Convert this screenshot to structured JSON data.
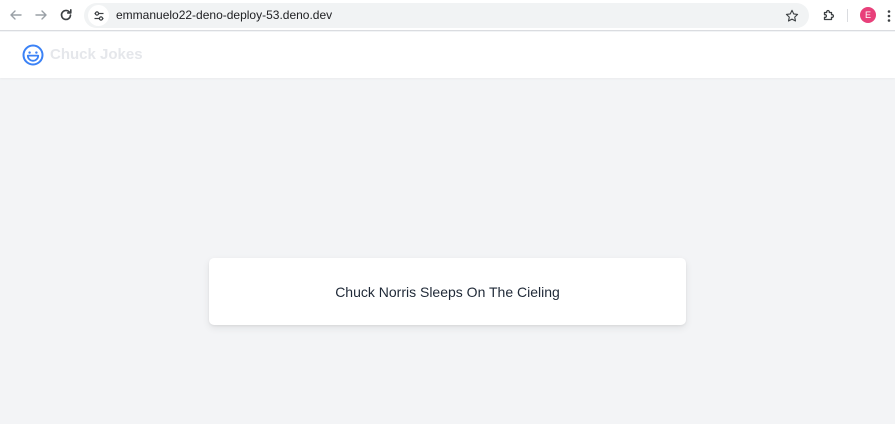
{
  "browser": {
    "url": "emmanuelo22-deno-deploy-53.deno.dev",
    "profile_initial": "E",
    "colors": {
      "profile": "#e8407a",
      "address_bar": "#f1f3f4"
    },
    "icons": {
      "back": "arrow-left-icon",
      "forward": "arrow-right-icon",
      "reload": "reload-icon",
      "site_info": "tune-icon",
      "bookmark": "star-icon",
      "extensions": "puzzle-icon",
      "menu": "kebab-menu-icon"
    }
  },
  "header": {
    "title": "Chuck Jokes",
    "logo_icon": "smiling-face-icon",
    "colors": {
      "logo": "#3b82f6",
      "title": "#e5e7eb"
    }
  },
  "main": {
    "joke": "Chuck Norris Sleeps On The Cieling",
    "colors": {
      "background": "#f3f4f6",
      "card": "#ffffff",
      "text": "#1f2937"
    }
  }
}
